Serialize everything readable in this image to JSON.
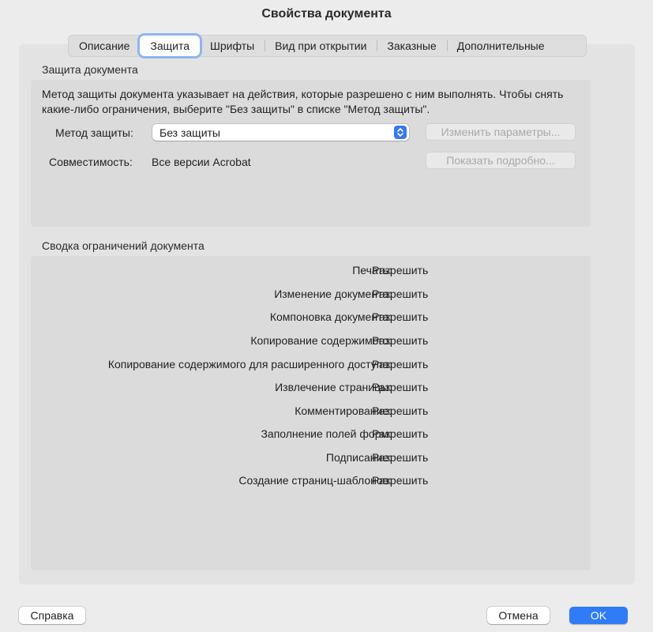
{
  "window": {
    "title": "Свойства документа"
  },
  "tabs": [
    {
      "label": "Описание"
    },
    {
      "label": "Защита",
      "active": true
    },
    {
      "label": "Шрифты"
    },
    {
      "label": "Вид при открытии"
    },
    {
      "label": "Заказные"
    },
    {
      "label": "Дополнительные"
    }
  ],
  "security": {
    "title": "Защита документа",
    "description": "Метод защиты документа указывает на действия, которые разрешено с ним выполнять. Чтобы снять какие-либо ограничения, выберите \"Без защиты\" в списке \"Метод защиты\".",
    "method_label": "Метод защиты:",
    "method_value": "Без защиты",
    "change_settings_button": "Изменить параметры...",
    "compat_label": "Совместимость:",
    "compat_value": "Все версии Acrobat",
    "show_details_button": "Показать подробно..."
  },
  "restrictions": {
    "title": "Сводка ограничений документа",
    "rows": [
      {
        "label": "Печать:",
        "value": "Разрешить"
      },
      {
        "label": "Изменение документа:",
        "value": "Разрешить"
      },
      {
        "label": "Компоновка документа:",
        "value": "Разрешить"
      },
      {
        "label": "Копирование содержимого:",
        "value": "Разрешить"
      },
      {
        "label": "Копирование содержимого для расширенного доступа:",
        "value": "Разрешить"
      },
      {
        "label": "Извлечение страницы:",
        "value": "Разрешить"
      },
      {
        "label": "Комментирование:",
        "value": "Разрешить"
      },
      {
        "label": "Заполнение полей форм:",
        "value": "Разрешить"
      },
      {
        "label": "Подписание:",
        "value": "Разрешить"
      },
      {
        "label": "Создание страниц-шаблонов:",
        "value": "Разрешить"
      }
    ]
  },
  "footer": {
    "help_button": "Справка",
    "cancel_button": "Отмена",
    "ok_button": "OK"
  },
  "colors": {
    "accent": "#2f7cf6",
    "focus_ring": "#8fb5f1"
  },
  "icons": {
    "select_arrow": "up-down-chevron-icon"
  }
}
